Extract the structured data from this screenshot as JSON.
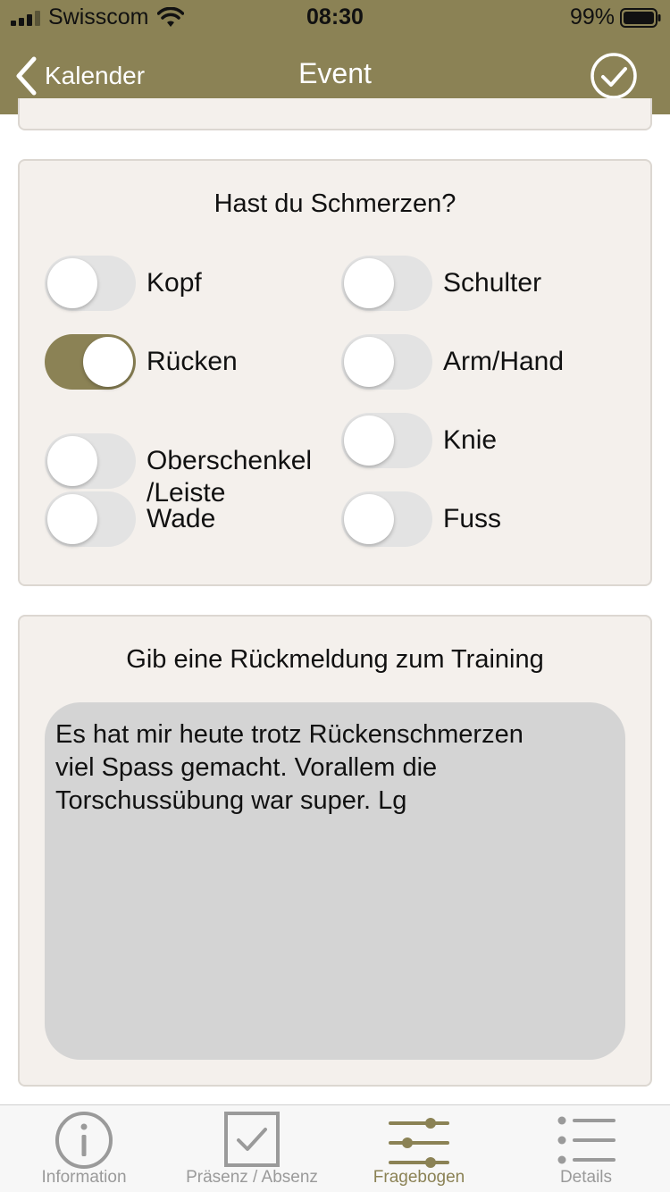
{
  "status_bar": {
    "carrier": "Swisscom",
    "time": "08:30",
    "battery_percent": "99%"
  },
  "nav": {
    "back_label": "Kalender",
    "title": "Event"
  },
  "pain_card": {
    "title": "Hast du Schmerzen?",
    "toggles": [
      {
        "label": "Kopf",
        "on": false
      },
      {
        "label": "Schulter",
        "on": false
      },
      {
        "label": "Rücken",
        "on": true
      },
      {
        "label": "Arm/Hand",
        "on": false
      },
      {
        "label_line1": "Oberschenkel",
        "label_line2": "/Leiste",
        "on": false
      },
      {
        "label": "Knie",
        "on": false
      },
      {
        "label": "Wade",
        "on": false
      },
      {
        "label": "Fuss",
        "on": false
      }
    ]
  },
  "feedback_card": {
    "title": "Gib eine Rückmeldung zum Training",
    "text_line1": "Es hat mir heute trotz Rückenschmerzen",
    "text_line2": "viel Spass gemacht. Vorallem die",
    "text_line3": "Torschussübung war super. Lg"
  },
  "tabbar": {
    "tabs": [
      {
        "label": "Information",
        "icon": "info-icon",
        "active": false
      },
      {
        "label": "Präsenz / Absenz",
        "icon": "checkbox-icon",
        "active": false
      },
      {
        "label": "Fragebogen",
        "icon": "sliders-icon",
        "active": true
      },
      {
        "label": "Details",
        "icon": "list-icon",
        "active": false
      }
    ]
  },
  "colors": {
    "accent": "#8b8255",
    "card_bg": "#f4f0ec",
    "textarea_bg": "#d4d4d4"
  }
}
